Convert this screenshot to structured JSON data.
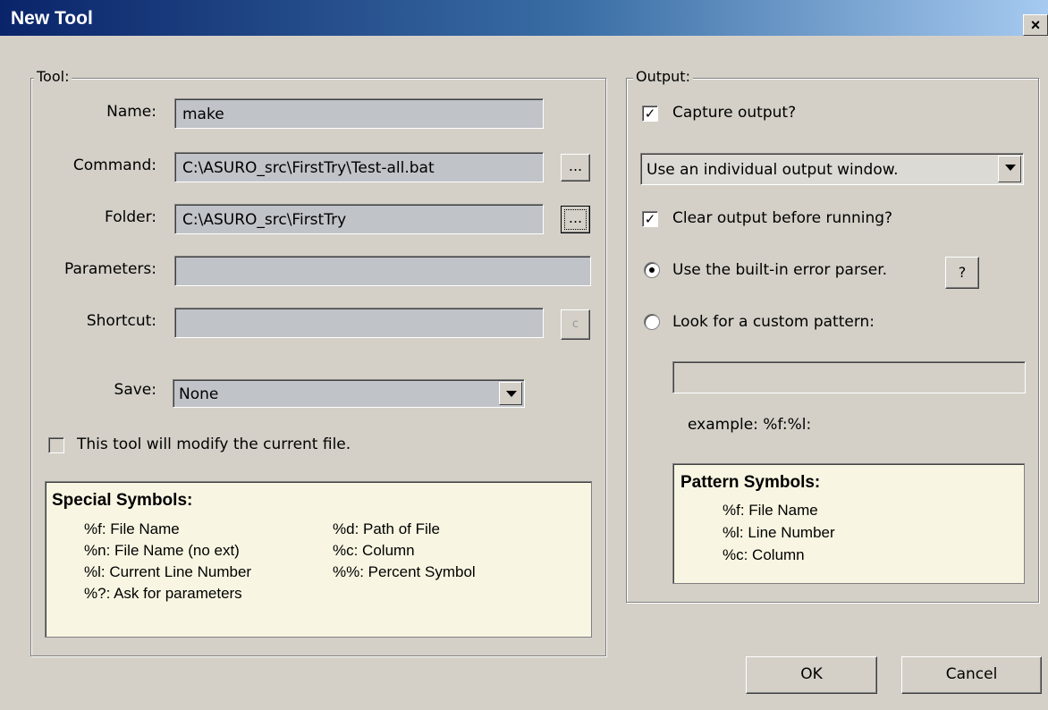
{
  "window": {
    "title": "New Tool",
    "close_label": "×"
  },
  "tool_group": {
    "legend": "Tool:",
    "name": {
      "label": "Name:",
      "value": "make"
    },
    "command": {
      "label": "Command:",
      "value": "C:\\ASURO_src\\FirstTry\\Test-all.bat",
      "browse_label": "..."
    },
    "folder": {
      "label": "Folder:",
      "value": "C:\\ASURO_src\\FirstTry",
      "browse_label": "..."
    },
    "parameters": {
      "label": "Parameters:",
      "value": ""
    },
    "shortcut": {
      "label": "Shortcut:",
      "value": "",
      "clear_label": "c"
    },
    "save": {
      "label": "Save:",
      "value": "None"
    },
    "modify_checkbox": {
      "label": "This tool will modify the current file.",
      "checked": false
    }
  },
  "special_symbols": {
    "heading": "Special Symbols:",
    "left": [
      "%f: File Name",
      "%n: File Name (no ext)",
      "%l: Current Line Number",
      "%?: Ask for parameters"
    ],
    "right": [
      "%d: Path of File",
      "%c: Column",
      "%%: Percent Symbol"
    ]
  },
  "output_group": {
    "legend": "Output:",
    "capture": {
      "label": "Capture output?",
      "checked": true
    },
    "output_window": {
      "value": "Use an individual output window."
    },
    "clear": {
      "label": "Clear output before running?",
      "checked": true
    },
    "builtin_parser": {
      "label": "Use the built-in error parser.",
      "selected": true,
      "help_label": "?"
    },
    "custom_pattern": {
      "label": "Look for a custom pattern:",
      "selected": false,
      "value": ""
    },
    "example": "example: %f:%l:"
  },
  "pattern_symbols": {
    "heading": "Pattern Symbols:",
    "items": [
      "%f: File Name",
      "%l: Line Number",
      "%c: Column"
    ]
  },
  "buttons": {
    "ok": "OK",
    "cancel": "Cancel"
  },
  "colors": {
    "title_start": "#0a246a",
    "title_end": "#a6caf0",
    "face": "#d4d0c8",
    "info_bg": "#f8f6e2"
  }
}
